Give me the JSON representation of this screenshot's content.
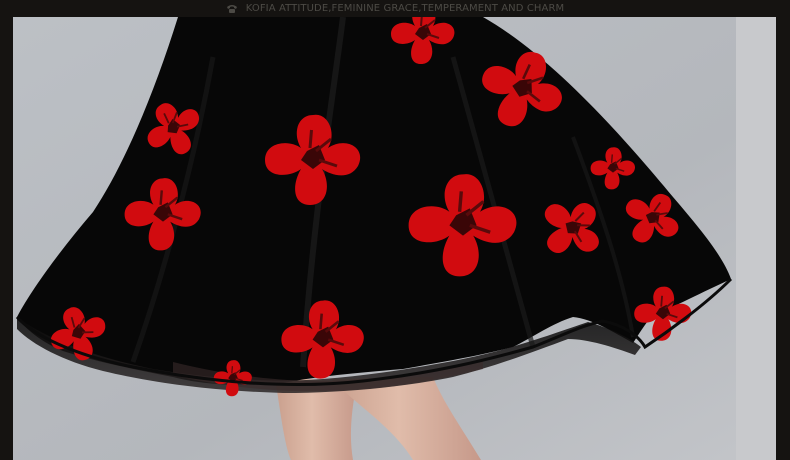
{
  "header": {
    "tagline": "KOFIA ATTITUDE,FEMININE GRACE,TEMPERAMENT AND CHARM",
    "icon": "phone-icon"
  },
  "photo": {
    "subject": "dress-skirt-photo",
    "colors": {
      "background": "#b9bcc1",
      "fabric": "#070707",
      "flowers": "#d10b0f",
      "leg": "#d6b1a0"
    }
  }
}
